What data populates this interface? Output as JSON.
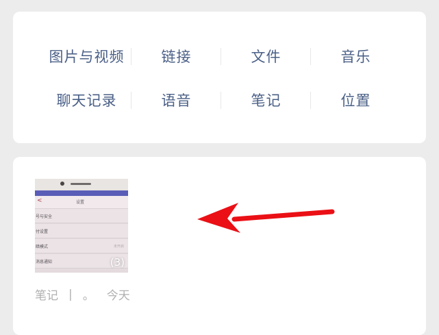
{
  "categories": {
    "row1": [
      "图片与视频",
      "链接",
      "文件",
      "音乐"
    ],
    "row2": [
      "聊天记录",
      "语音",
      "笔记",
      "位置"
    ]
  },
  "result": {
    "thumbnail": {
      "nav_back": "<",
      "nav_title": "设置",
      "settings_rows": [
        "号与安全",
        "付设置",
        "暗模式",
        "消息通知"
      ],
      "settings_value": "未开启",
      "count": "(3)"
    },
    "meta": {
      "type": "笔记",
      "separator": "|",
      "dot": "。",
      "date": "今天"
    }
  },
  "colors": {
    "category_text": "#4a5f86",
    "meta_text": "#b0b0b0",
    "arrow": "#ea1015",
    "background": "#ececec"
  }
}
